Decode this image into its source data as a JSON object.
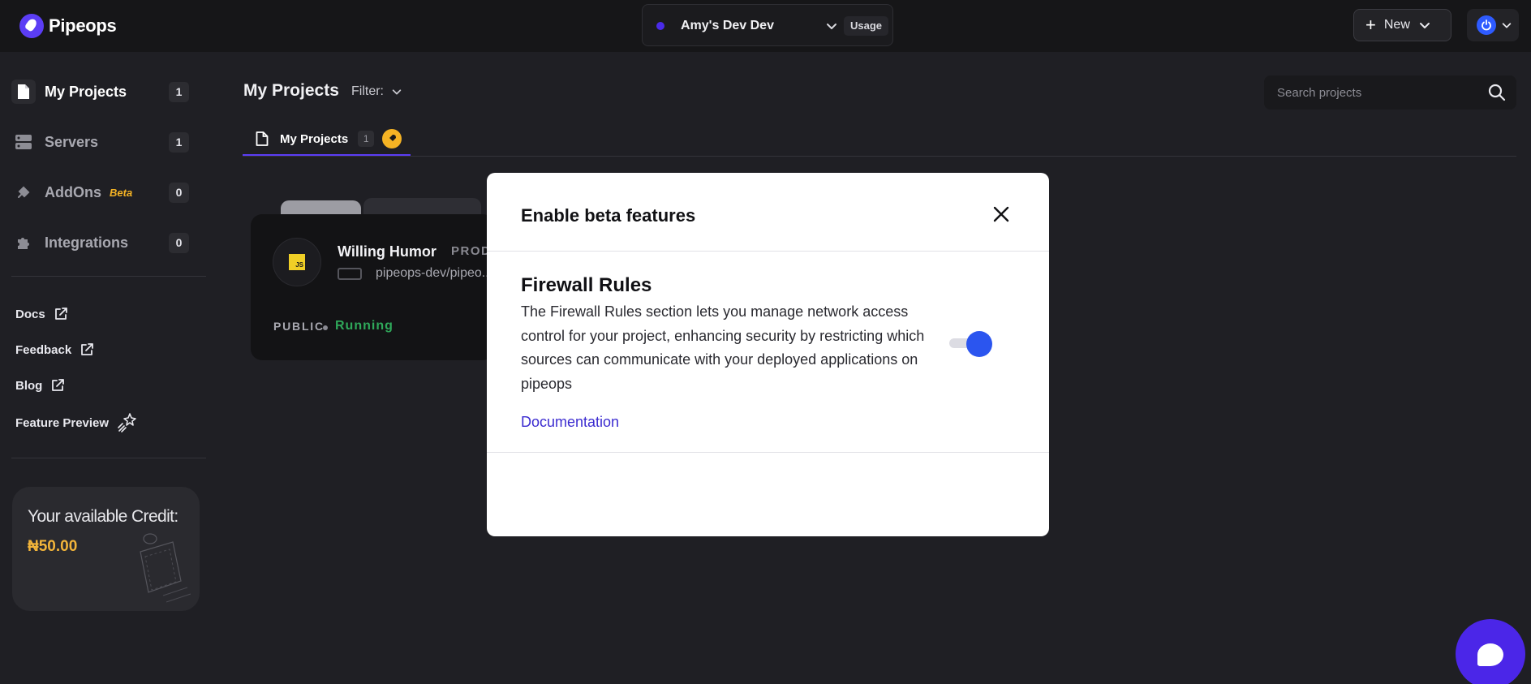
{
  "app": {
    "name": "Pipeops"
  },
  "header": {
    "workspace_name": "Amy's Dev Dev",
    "usage_label": "Usage",
    "new_label": "New"
  },
  "sidebar": {
    "items": [
      {
        "label": "My Projects",
        "count": "1",
        "icon": "file-icon"
      },
      {
        "label": "Servers",
        "count": "1",
        "icon": "server-icon"
      },
      {
        "label": "AddOns",
        "count": "0",
        "badge": "Beta",
        "icon": "plug-icon"
      },
      {
        "label": "Integrations",
        "count": "0",
        "icon": "puzzle-icon"
      }
    ],
    "links": [
      {
        "label": "Docs",
        "icon": "external-link-icon"
      },
      {
        "label": "Feedback",
        "icon": "external-link-icon"
      },
      {
        "label": "Blog",
        "icon": "external-link-icon"
      },
      {
        "label": "Feature Preview",
        "icon": "sparkle-rocket-icon"
      }
    ],
    "credit": {
      "title": "Your available Credit:",
      "value": "₦50.00"
    }
  },
  "main": {
    "title": "My Projects",
    "filter_label": "Filter:",
    "search_placeholder": "Search projects",
    "tab": {
      "label": "My Projects",
      "count": "1"
    },
    "project": {
      "name": "Willing Humor",
      "env": "PROD",
      "repo": "pipeops-dev/pipeo...",
      "visibility": "PUBLIC",
      "status": "Running",
      "status_color": "#2fa85a"
    }
  },
  "modal": {
    "title": "Enable beta features",
    "feature_title": "Firewall Rules",
    "feature_description": "The Firewall Rules section lets you manage network access control for your project, enhancing security by restricting which sources can communicate with your deployed applications on pipeops",
    "doc_link": "Documentation",
    "toggle_on": true
  },
  "colors": {
    "accent": "#5b3df5",
    "toggle_on": "#2b55ef",
    "credit_gold": "#f2b43a"
  }
}
